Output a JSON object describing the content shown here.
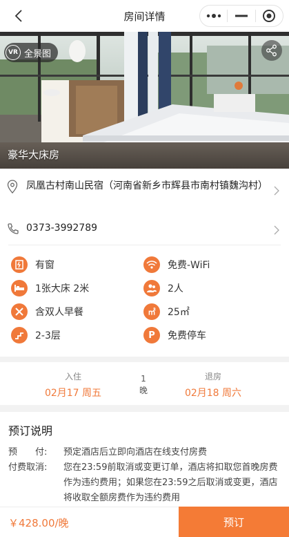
{
  "nav": {
    "title": "房间详情"
  },
  "hero": {
    "vr_icon_text": "VR",
    "vr_label": "全景图",
    "room_name": "豪华大床房"
  },
  "info": {
    "address": "凤凰古村南山民宿（河南省新乡市辉县市南村镇魏沟村）",
    "phone": "0373-3992789"
  },
  "amenities": [
    {
      "label": "有窗",
      "icon": "window-icon"
    },
    {
      "label": "免费-WiFi",
      "icon": "wifi-icon"
    },
    {
      "label": "1张大床 2米",
      "icon": "bed-icon"
    },
    {
      "label": "2人",
      "icon": "people-icon"
    },
    {
      "label": "含双人早餐",
      "icon": "breakfast-icon"
    },
    {
      "label": "25㎡",
      "icon": "area-icon",
      "icon_text": "㎡"
    },
    {
      "label": "2-3层",
      "icon": "stairs-icon"
    },
    {
      "label": "免费停车",
      "icon": "parking-icon",
      "icon_text": "P"
    }
  ],
  "dates": {
    "checkin_label": "入住",
    "checkin_value": "02月17 周五",
    "nights_value": "1",
    "nights_unit": "晚",
    "checkout_label": "退房",
    "checkout_value": "02月18 周六"
  },
  "notes": {
    "title": "预订说明",
    "rows": [
      {
        "label": "预　　付:",
        "text": "预定酒店后立即向酒店在线支付房费"
      },
      {
        "label": "付费取消:",
        "text": "您在23:59前取消或变更订单，酒店将扣取您首晚房费作为违约费用；如果您在23:59之后取消或变更，酒店将收取全额房费作为违约费用"
      }
    ]
  },
  "footer": {
    "price": "￥428.00/晚",
    "book_label": "预订"
  },
  "colors": {
    "accent": "#f0793a",
    "button": "#f47b36"
  }
}
